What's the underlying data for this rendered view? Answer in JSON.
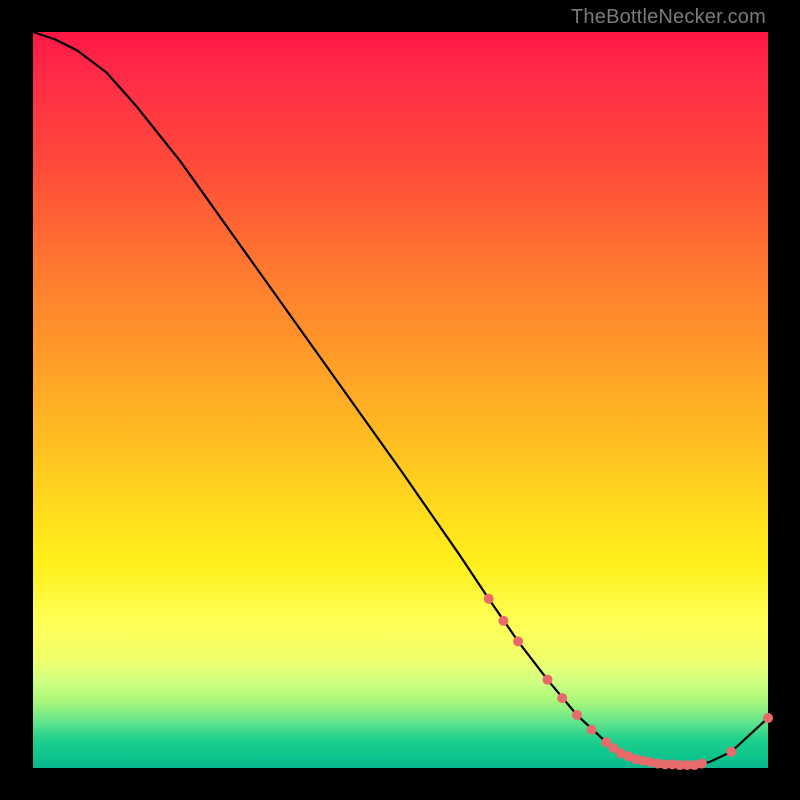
{
  "attribution": "TheBottleNecker.com",
  "colors": {
    "curve": "#000000",
    "marker": "#e96a6a"
  },
  "chart_data": {
    "type": "line",
    "title": "",
    "xlabel": "",
    "ylabel": "",
    "xlim": [
      0,
      100
    ],
    "ylim": [
      0,
      100
    ],
    "x": [
      0,
      3,
      6,
      10,
      14,
      20,
      30,
      40,
      50,
      58,
      62,
      66,
      70,
      74,
      78,
      81,
      84,
      86,
      88,
      90,
      92,
      95,
      100
    ],
    "y": [
      100,
      99,
      97.5,
      94.5,
      90,
      82.5,
      68.5,
      54.5,
      40.5,
      29,
      23,
      17.2,
      12,
      7.2,
      3.5,
      1.6,
      0.8,
      0.5,
      0.4,
      0.4,
      0.8,
      2.2,
      6.8
    ],
    "markers_x": [
      62,
      64,
      66,
      70,
      72,
      74,
      76,
      78,
      79,
      80,
      81,
      82,
      83,
      84,
      85,
      86,
      87,
      88,
      89,
      90,
      91,
      95,
      100
    ],
    "markers_y": [
      23,
      20,
      17.2,
      12,
      9.5,
      7.2,
      5.2,
      3.5,
      2.7,
      2.0,
      1.6,
      1.2,
      1.0,
      0.8,
      0.6,
      0.5,
      0.5,
      0.4,
      0.4,
      0.4,
      0.6,
      2.2,
      6.8
    ],
    "grid": false,
    "legend": null
  }
}
